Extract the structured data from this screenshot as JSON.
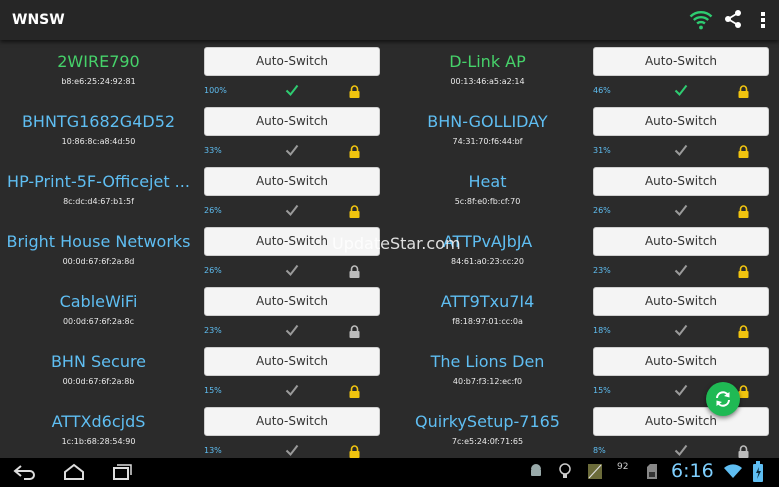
{
  "app": {
    "title": "WNSW"
  },
  "actionbar": {
    "icons": [
      "wifi-icon",
      "share-icon",
      "overflow-menu-icon"
    ],
    "wifi_color": "#2ecc71"
  },
  "networks_left": [
    {
      "ssid": "2WIRE790",
      "mac": "b8:e6:25:24:92:81",
      "button": "Auto-Switch",
      "signal": "100%",
      "connected": true,
      "lock": "gold"
    },
    {
      "ssid": "BHNTG1682G4D52",
      "mac": "10:86:8c:a8:4d:50",
      "button": "Auto-Switch",
      "signal": "33%",
      "connected": false,
      "lock": "gold"
    },
    {
      "ssid": "HP-Print-5F-Officejet ...",
      "mac": "8c:dc:d4:67:b1:5f",
      "button": "Auto-Switch",
      "signal": "26%",
      "connected": false,
      "lock": "gold"
    },
    {
      "ssid": "Bright House Networks",
      "mac": "00:0d:67:6f:2a:8d",
      "button": "Auto-Switch",
      "signal": "26%",
      "connected": false,
      "lock": "grey"
    },
    {
      "ssid": "CableWiFi",
      "mac": "00:0d:67:6f:2a:8c",
      "button": "Auto-Switch",
      "signal": "23%",
      "connected": false,
      "lock": "grey"
    },
    {
      "ssid": "BHN Secure",
      "mac": "00:0d:67:6f:2a:8b",
      "button": "Auto-Switch",
      "signal": "15%",
      "connected": false,
      "lock": "gold"
    },
    {
      "ssid": "ATTXd6cjdS",
      "mac": "1c:1b:68:28:54:90",
      "button": "Auto-Switch",
      "signal": "13%",
      "connected": false,
      "lock": "gold"
    }
  ],
  "networks_right": [
    {
      "ssid": "D-Link AP",
      "mac": "00:13:46:a5:a2:14",
      "button": "Auto-Switch",
      "signal": "46%",
      "connected": true,
      "lock": "gold"
    },
    {
      "ssid": "BHN-GOLLIDAY",
      "mac": "74:31:70:f6:44:bf",
      "button": "Auto-Switch",
      "signal": "31%",
      "connected": false,
      "lock": "gold"
    },
    {
      "ssid": "Heat",
      "mac": "5c:8f:e0:fb:cf:70",
      "button": "Auto-Switch",
      "signal": "26%",
      "connected": false,
      "lock": "gold"
    },
    {
      "ssid": "ATTPvAJbJA",
      "mac": "84:61:a0:23:cc:20",
      "button": "Auto-Switch",
      "signal": "23%",
      "connected": false,
      "lock": "gold"
    },
    {
      "ssid": "ATT9Txu7I4",
      "mac": "f8:18:97:01:cc:0a",
      "button": "Auto-Switch",
      "signal": "18%",
      "connected": false,
      "lock": "gold"
    },
    {
      "ssid": "The Lions Den",
      "mac": "40:b7:f3:12:ec:f0",
      "button": "Auto-Switch",
      "signal": "15%",
      "connected": false,
      "lock": "gold"
    },
    {
      "ssid": "QuirkySetup-7165",
      "mac": "7c:e5:24:0f:71:65",
      "button": "Auto-Switch",
      "signal": "8%",
      "connected": false,
      "lock": "grey"
    }
  ],
  "watermark": "UpdateStar.com",
  "fab": {
    "icon": "refresh-icon",
    "color": "#1fb954"
  },
  "status_bar": {
    "time": "6:16",
    "notification_count": "92",
    "icons": [
      "back-icon",
      "home-icon",
      "recent-apps-icon",
      "android-icon",
      "lightbulb-icon",
      "image-icon",
      "sd-card-icon",
      "wifi-icon",
      "battery-icon"
    ]
  }
}
